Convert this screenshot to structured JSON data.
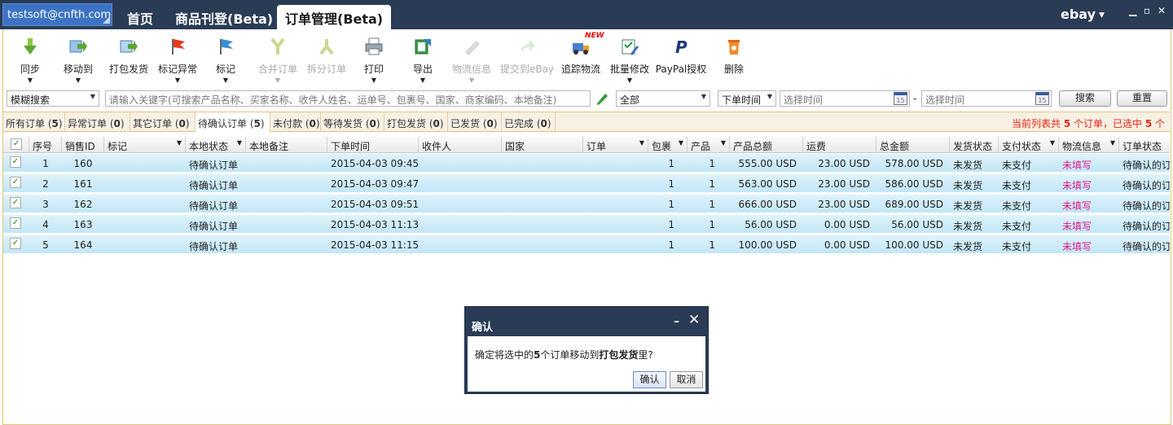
{
  "account": "testsoft@cnfth.com",
  "nav": [
    "首页",
    "商品刊登(Beta)",
    "订单管理(Beta)"
  ],
  "platform": "ebay",
  "window_controls": [
    "▁",
    "▫",
    "✕"
  ],
  "toolbar": [
    {
      "label": "同步",
      "icon": "sync-down-arrow-icon",
      "dropdown": true,
      "disabled": false
    },
    {
      "label": "移动到",
      "icon": "move-to-icon",
      "dropdown": true,
      "disabled": false
    },
    {
      "label": "打包发货",
      "icon": "pack-ship-icon",
      "dropdown": false,
      "disabled": false
    },
    {
      "label": "标记异常",
      "icon": "red-flag-icon",
      "dropdown": true,
      "disabled": false
    },
    {
      "label": "标记",
      "icon": "blue-flag-icon",
      "dropdown": true,
      "disabled": false
    },
    {
      "label": "合并订单",
      "icon": "merge-icon",
      "dropdown": true,
      "disabled": true
    },
    {
      "label": "拆分订单",
      "icon": "split-icon",
      "dropdown": false,
      "disabled": true
    },
    {
      "label": "打印",
      "icon": "printer-icon",
      "dropdown": true,
      "disabled": false
    },
    {
      "label": "导出",
      "icon": "export-icon",
      "dropdown": true,
      "disabled": false
    },
    {
      "label": "物流信息",
      "icon": "pencil-icon",
      "dropdown": true,
      "disabled": true
    },
    {
      "label": "提交到eBay",
      "icon": "submit-arrow-icon",
      "dropdown": false,
      "disabled": true
    },
    {
      "label": "追踪物流",
      "icon": "truck-icon",
      "dropdown": false,
      "disabled": false,
      "badge": "NEW"
    },
    {
      "label": "批量修改",
      "icon": "batch-edit-icon",
      "dropdown": true,
      "disabled": false
    },
    {
      "label": "PayPal授权",
      "icon": "paypal-icon",
      "dropdown": false,
      "disabled": false
    },
    {
      "label": "删除",
      "icon": "trash-icon",
      "dropdown": false,
      "disabled": false
    }
  ],
  "search": {
    "mode": "模糊搜索",
    "keyword_placeholder": "请输入关键字(可搜索产品名称、买家名称、收件人姓名、运单号、包裹号、国家、商家编码、本地备注)",
    "filter": "全部",
    "time_field": "下单时间",
    "from_placeholder": "选择时间",
    "separator": "-",
    "to_placeholder": "选择时间",
    "calendar_day": "15",
    "search_btn": "搜索",
    "reset_btn": "重置"
  },
  "tabs": [
    {
      "label": "所有订单",
      "count": "5"
    },
    {
      "label": "异常订单",
      "count": "0"
    },
    {
      "label": "其它订单",
      "count": "0"
    },
    {
      "label": "待确认订单",
      "count": "5"
    },
    {
      "label": "未付款",
      "count": "0"
    },
    {
      "label": "等待发货",
      "count": "0"
    },
    {
      "label": "打包发货",
      "count": "0"
    },
    {
      "label": "已发货",
      "count": "0"
    },
    {
      "label": "已完成",
      "count": "0"
    }
  ],
  "active_tab": 3,
  "selection_summary": {
    "prefix": "当前列表共 ",
    "total": "5",
    "mid": " 个订单，已选中 ",
    "selected": "5",
    "suffix": " 个"
  },
  "columns": [
    "序号",
    "销售ID",
    "标记",
    "本地状态",
    "本地备注",
    "下单时间",
    "收件人",
    "国家",
    "订单",
    "包裹",
    "产品",
    "产品总额",
    "运费",
    "总金额",
    "发货状态",
    "支付状态",
    "物流信息",
    "订单状态"
  ],
  "rows": [
    {
      "seq": "1",
      "sale_id": "160",
      "local_status": "待确认订单",
      "order_time": "2015-04-03 09:45",
      "packages": "1",
      "products": "1",
      "product_total": "555.00 USD",
      "shipping": "23.00 USD",
      "total": "578.00 USD",
      "ship_status": "未发货",
      "pay_status": "未支付",
      "logistics": "未填写",
      "order_status": "待确认的订单"
    },
    {
      "seq": "2",
      "sale_id": "161",
      "local_status": "待确认订单",
      "order_time": "2015-04-03 09:47",
      "packages": "1",
      "products": "1",
      "product_total": "563.00 USD",
      "shipping": "23.00 USD",
      "total": "586.00 USD",
      "ship_status": "未发货",
      "pay_status": "未支付",
      "logistics": "未填写",
      "order_status": "待确认的订单"
    },
    {
      "seq": "3",
      "sale_id": "162",
      "local_status": "待确认订单",
      "order_time": "2015-04-03 09:51",
      "packages": "1",
      "products": "1",
      "product_total": "666.00 USD",
      "shipping": "23.00 USD",
      "total": "689.00 USD",
      "ship_status": "未发货",
      "pay_status": "未支付",
      "logistics": "未填写",
      "order_status": "待确认的订单"
    },
    {
      "seq": "4",
      "sale_id": "163",
      "local_status": "待确认订单",
      "order_time": "2015-04-03 11:13",
      "packages": "1",
      "products": "1",
      "product_total": "56.00 USD",
      "shipping": "0.00 USD",
      "total": "56.00 USD",
      "ship_status": "未发货",
      "pay_status": "未支付",
      "logistics": "未填写",
      "order_status": "待确认的订单"
    },
    {
      "seq": "5",
      "sale_id": "164",
      "local_status": "待确认订单",
      "order_time": "2015-04-03 11:15",
      "packages": "1",
      "products": "1",
      "product_total": "100.00 USD",
      "shipping": "0.00 USD",
      "total": "100.00 USD",
      "ship_status": "未发货",
      "pay_status": "未支付",
      "logistics": "未填写",
      "order_status": "待确认的订单"
    }
  ],
  "dialog": {
    "title": "确认",
    "msg_prefix": "确定将选中的",
    "msg_count": "5",
    "msg_mid": "个订单移动到",
    "msg_target": "打包发货",
    "msg_suffix": "里?",
    "ok": "确认",
    "cancel": "取消",
    "minimize": "–",
    "close": "✕"
  },
  "colors": {
    "header_bg": "#2a3b55",
    "account_bg": "#3d73c4",
    "row_bg": "#c9e9f7",
    "alert_red": "#e21111",
    "link_pink": "#e0188a",
    "frame_border": "#e4c47c"
  }
}
